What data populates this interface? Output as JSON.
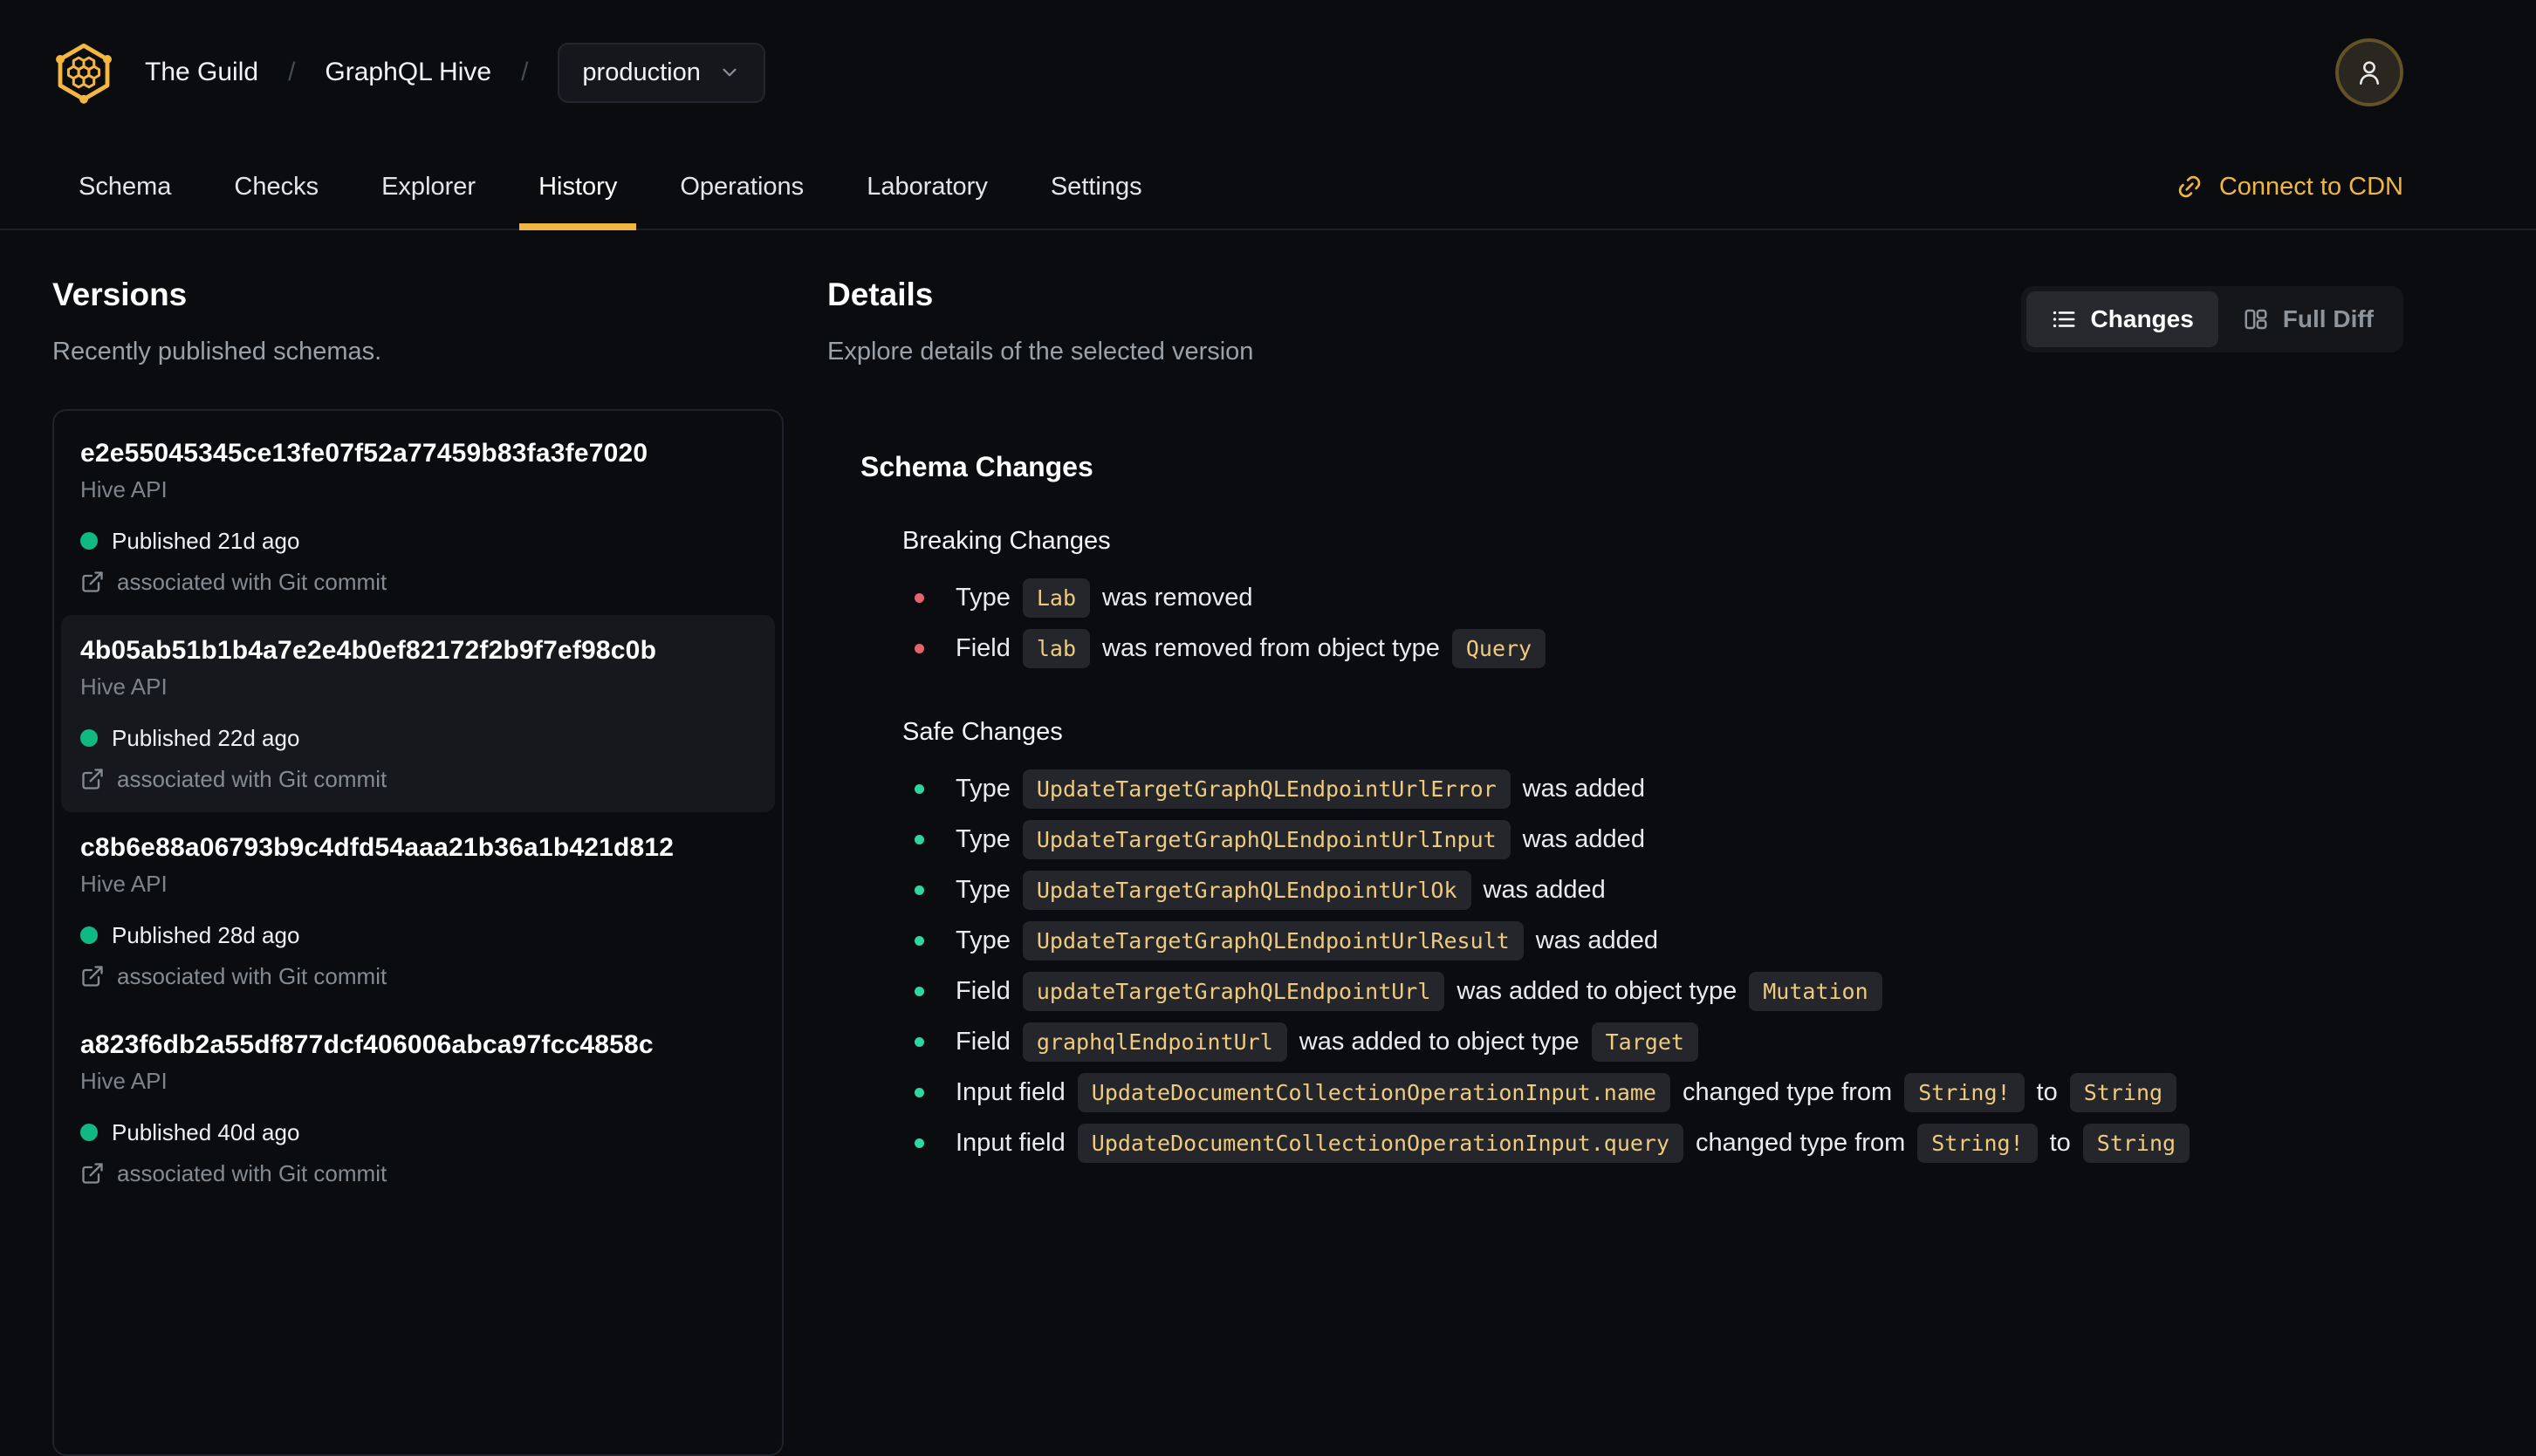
{
  "theme": {
    "background": "#0a0c10",
    "accent": "#f1b63f",
    "logo_color": "#f4b740",
    "breaking_color": "#e5636c",
    "safe_color": "#2fd6a2",
    "published_dot_color": "#10b981",
    "code_text_color": "#eecb7d"
  },
  "header": {
    "logo_icon": "hive-logo-icon",
    "breadcrumb": {
      "org": "The Guild",
      "separator": "/",
      "project": "GraphQL Hive",
      "target": "production",
      "target_chevron_icon": "chevron-down-icon"
    },
    "avatar_icon": "user-icon",
    "tabs": [
      {
        "label": "Schema",
        "active": false
      },
      {
        "label": "Checks",
        "active": false
      },
      {
        "label": "Explorer",
        "active": false
      },
      {
        "label": "History",
        "active": true
      },
      {
        "label": "Operations",
        "active": false
      },
      {
        "label": "Laboratory",
        "active": false
      },
      {
        "label": "Settings",
        "active": false
      }
    ],
    "connect_cdn": {
      "label": "Connect to CDN",
      "icon": "link-icon"
    }
  },
  "versions": {
    "title": "Versions",
    "subtitle": "Recently published schemas.",
    "items": [
      {
        "hash": "e2e55045345ce13fe07f52a77459b83fa3fe7020",
        "service": "Hive API",
        "published": "Published 21d ago",
        "git": "associated with Git commit",
        "selected": false
      },
      {
        "hash": "4b05ab51b1b4a7e2e4b0ef82172f2b9f7ef98c0b",
        "service": "Hive API",
        "published": "Published 22d ago",
        "git": "associated with Git commit",
        "selected": true
      },
      {
        "hash": "c8b6e88a06793b9c4dfd54aaa21b36a1b421d812",
        "service": "Hive API",
        "published": "Published 28d ago",
        "git": "associated with Git commit",
        "selected": false
      },
      {
        "hash": "a823f6db2a55df877dcf406006abca97fcc4858c",
        "service": "Hive API",
        "published": "Published 40d ago",
        "git": "associated with Git commit",
        "selected": false
      }
    ]
  },
  "details": {
    "title": "Details",
    "subtitle": "Explore details of the selected version",
    "view_toggle": [
      {
        "label": "Changes",
        "icon": "list-icon",
        "active": true
      },
      {
        "label": "Full Diff",
        "icon": "columns-icon",
        "active": false
      }
    ],
    "schema_changes_title": "Schema Changes",
    "groups": [
      {
        "title": "Breaking Changes",
        "severity": "breaking",
        "items": [
          [
            {
              "text": "Type"
            },
            {
              "code": "Lab"
            },
            {
              "text": "was removed"
            }
          ],
          [
            {
              "text": "Field"
            },
            {
              "code": "lab"
            },
            {
              "text": "was removed from object type"
            },
            {
              "code": "Query"
            }
          ]
        ]
      },
      {
        "title": "Safe Changes",
        "severity": "safe",
        "items": [
          [
            {
              "text": "Type"
            },
            {
              "code": "UpdateTargetGraphQLEndpointUrlError"
            },
            {
              "text": "was added"
            }
          ],
          [
            {
              "text": "Type"
            },
            {
              "code": "UpdateTargetGraphQLEndpointUrlInput"
            },
            {
              "text": "was added"
            }
          ],
          [
            {
              "text": "Type"
            },
            {
              "code": "UpdateTargetGraphQLEndpointUrlOk"
            },
            {
              "text": "was added"
            }
          ],
          [
            {
              "text": "Type"
            },
            {
              "code": "UpdateTargetGraphQLEndpointUrlResult"
            },
            {
              "text": "was added"
            }
          ],
          [
            {
              "text": "Field"
            },
            {
              "code": "updateTargetGraphQLEndpointUrl"
            },
            {
              "text": "was added to object type"
            },
            {
              "code": "Mutation"
            }
          ],
          [
            {
              "text": "Field"
            },
            {
              "code": "graphqlEndpointUrl"
            },
            {
              "text": "was added to object type"
            },
            {
              "code": "Target"
            }
          ],
          [
            {
              "text": "Input field"
            },
            {
              "code": "UpdateDocumentCollectionOperationInput.name"
            },
            {
              "text": "changed type from"
            },
            {
              "code": "String!"
            },
            {
              "text": "to"
            },
            {
              "code": "String"
            }
          ],
          [
            {
              "text": "Input field"
            },
            {
              "code": "UpdateDocumentCollectionOperationInput.query"
            },
            {
              "text": "changed type from"
            },
            {
              "code": "String!"
            },
            {
              "text": "to"
            },
            {
              "code": "String"
            }
          ]
        ]
      }
    ]
  }
}
